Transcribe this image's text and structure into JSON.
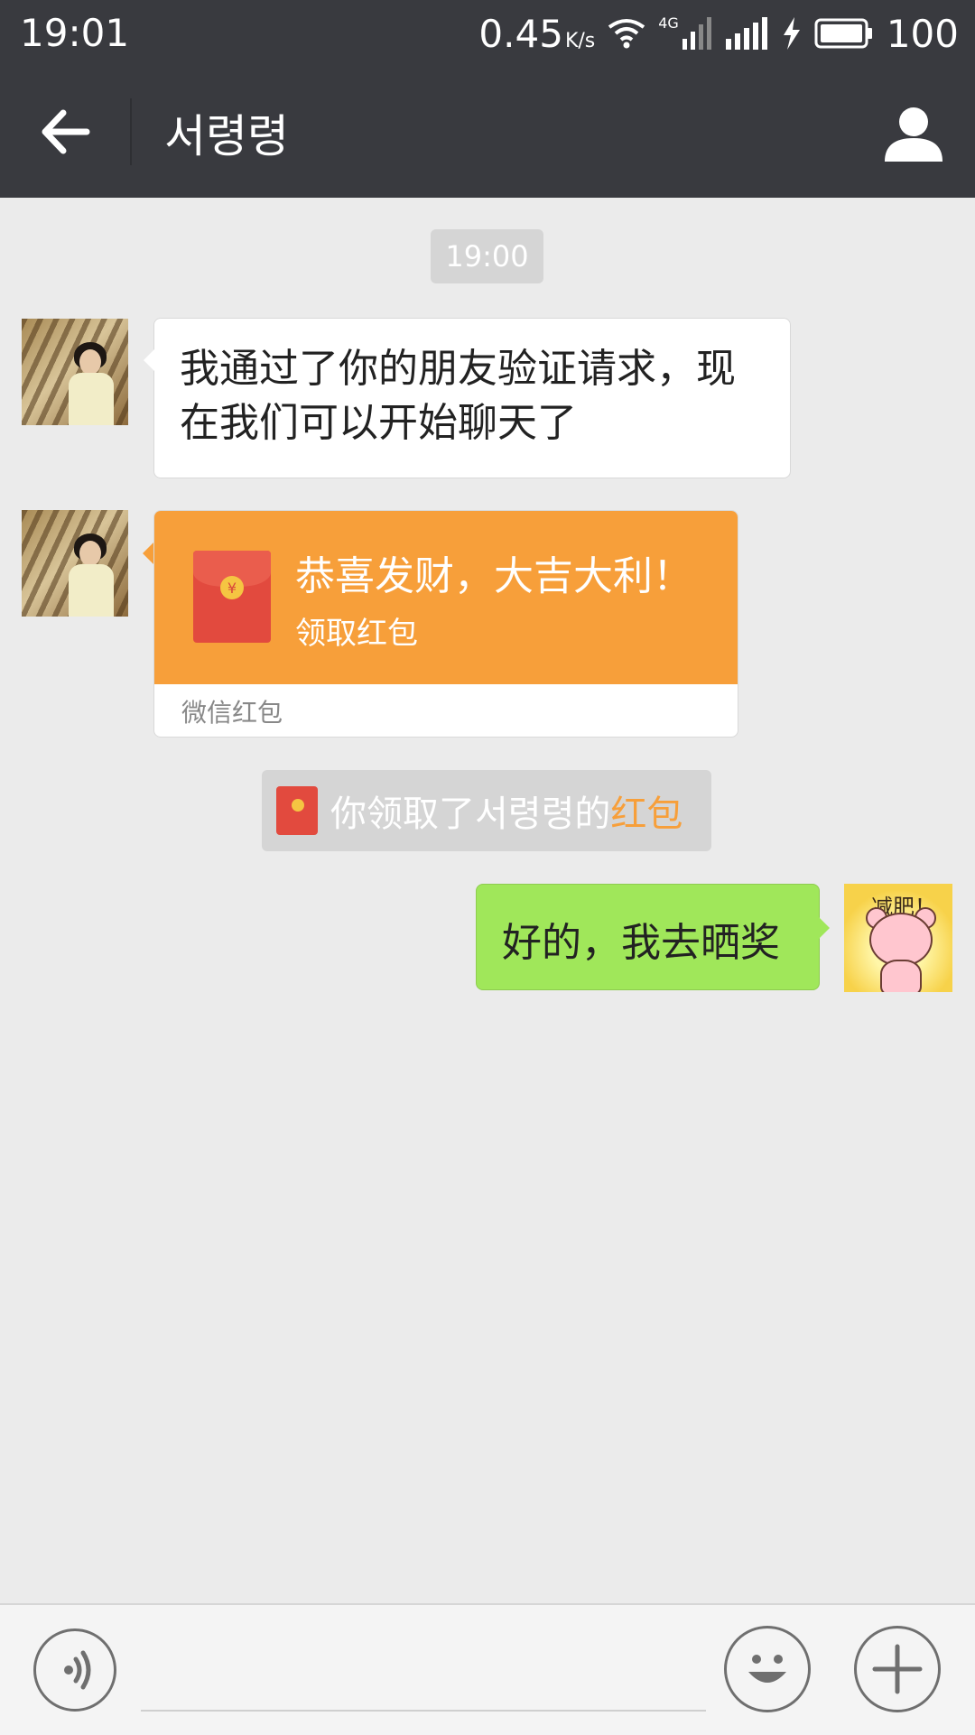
{
  "status_bar": {
    "time": "19:01",
    "net_speed": "0.45",
    "net_unit": "K/s",
    "network_type": "4G",
    "battery": "100"
  },
  "header": {
    "back_icon": "arrow-left-icon",
    "title": "서령령",
    "profile_icon": "person-icon"
  },
  "chat": {
    "timestamp": "19:00",
    "messages": [
      {
        "sender": "contact",
        "type": "text",
        "text": "我通过了你的朋友验证请求，现在我们可以开始聊天了"
      },
      {
        "sender": "contact",
        "type": "red_packet",
        "title": "恭喜发财，大吉大利！",
        "action": "领取红包",
        "footer": "微信红包"
      },
      {
        "sender": "system",
        "type": "notice",
        "text": "你领取了서령령的",
        "highlight": "红包"
      },
      {
        "sender": "me",
        "type": "text",
        "text": "好的，我去晒奖"
      }
    ],
    "my_sticker_text": "减肥！"
  },
  "input_bar": {
    "voice_icon": "voice-icon",
    "emoji_icon": "smiley-icon",
    "plus_icon": "plus-icon",
    "input_value": ""
  },
  "colors": {
    "header_bg": "#393a3f",
    "chat_bg": "#ebebeb",
    "red_packet": "#f79f3a",
    "my_bubble": "#a0e75a"
  }
}
